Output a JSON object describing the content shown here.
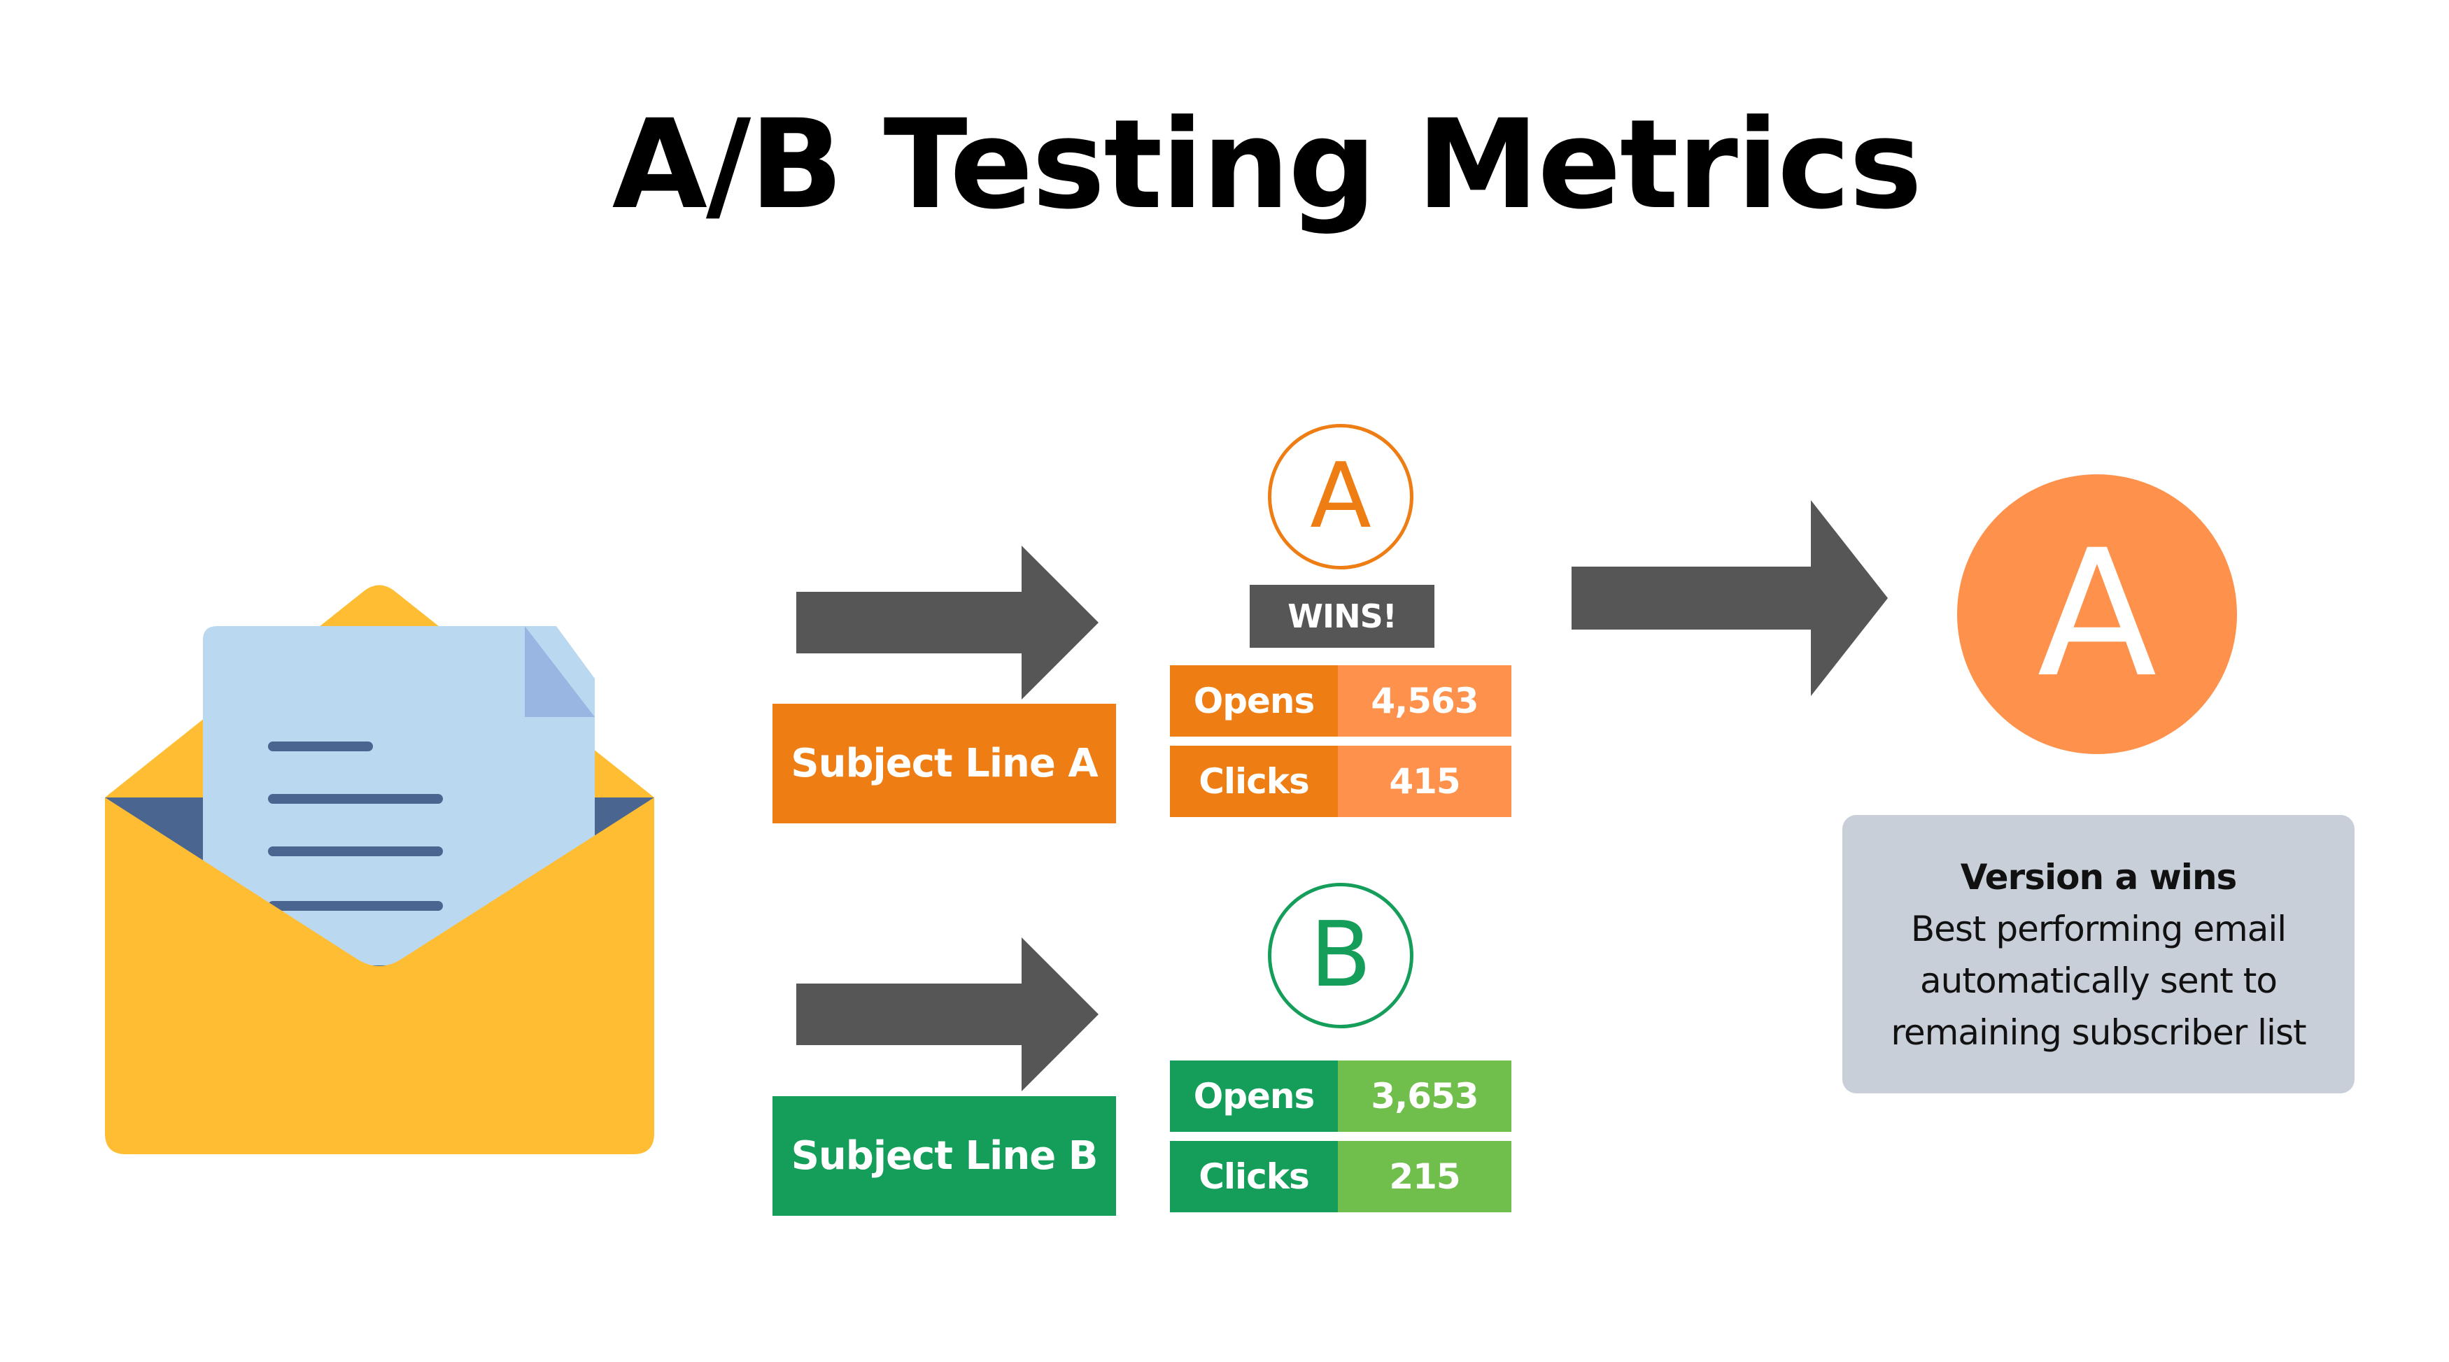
{
  "title": "A/B Testing Metrics",
  "icons": {
    "envelope": "open-envelope-with-letter-icon",
    "arrow": "right-arrow-icon"
  },
  "colors": {
    "variant_a_primary": "#ee7d14",
    "variant_a_secondary": "#fe924c",
    "variant_b_primary": "#149e5a",
    "variant_b_secondary": "#70be4c",
    "arrow": "#565656",
    "envelope": "#febd33",
    "envelope_inner": "#4a6690",
    "letter": "#bad9f1",
    "letter_fold": "#99b6e2",
    "info_box": "#c8cfd9"
  },
  "variants": [
    {
      "id": "A",
      "subject_label": "Subject Line A",
      "badge": "WINS!",
      "metrics": [
        {
          "label": "Opens",
          "value": "4,563"
        },
        {
          "label": "Clicks",
          "value": "415"
        }
      ]
    },
    {
      "id": "B",
      "subject_label": "Subject Line B",
      "metrics": [
        {
          "label": "Opens",
          "value": "3,653"
        },
        {
          "label": "Clicks",
          "value": "215"
        }
      ]
    }
  ],
  "winner": {
    "letter": "A",
    "headline": "Version a wins",
    "description_lines": [
      "Best performing email",
      "automatically sent to",
      "remaining subscriber list"
    ]
  }
}
